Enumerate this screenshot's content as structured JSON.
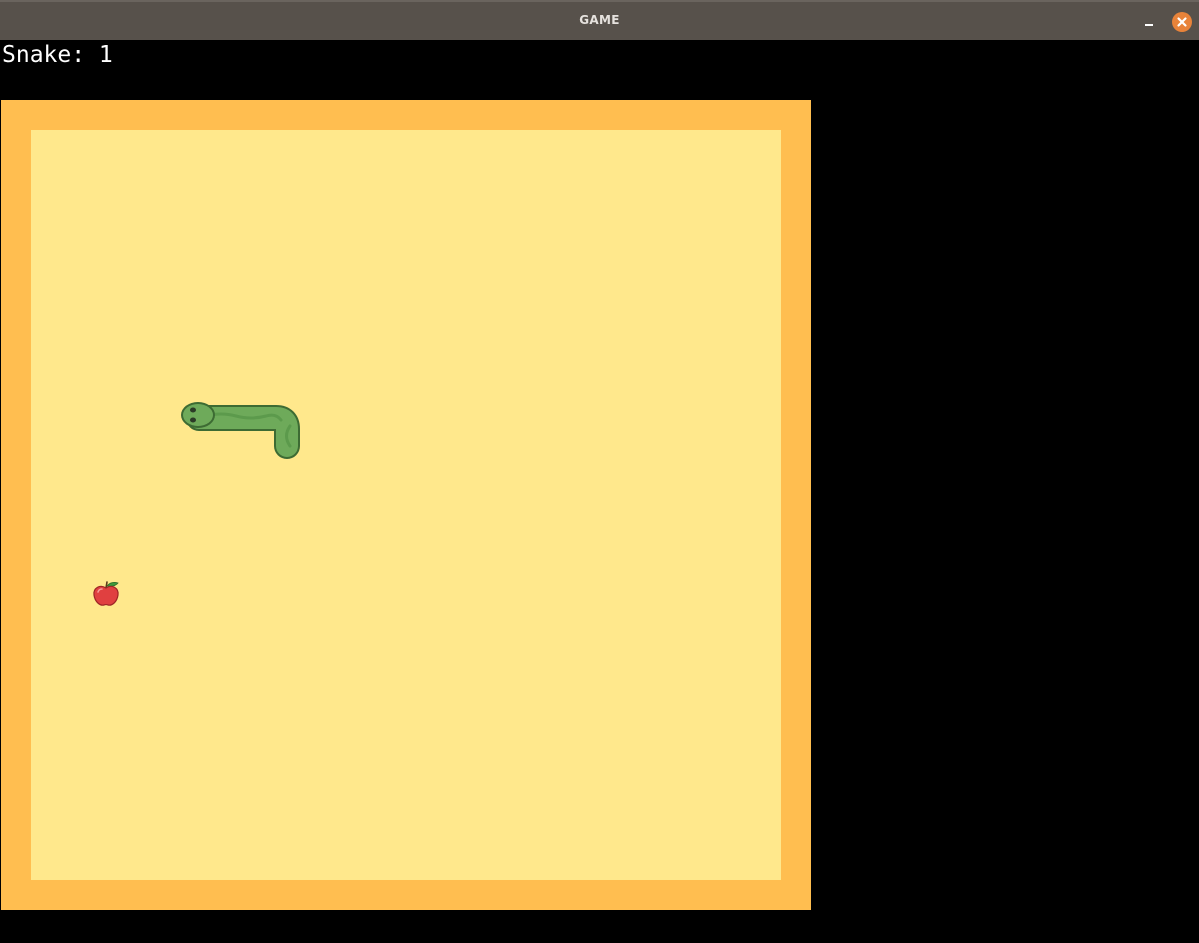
{
  "window": {
    "title": "GAME",
    "minimize_icon": "minimize-icon",
    "close_icon": "close-icon",
    "close_color": "#e8833a"
  },
  "hud": {
    "score_text": "Snake: 1"
  },
  "board": {
    "border_color": "#ffbe50",
    "field_color": "#ffe88c",
    "snake_color": "#6eaa5a",
    "apple_color": "#e04040"
  }
}
